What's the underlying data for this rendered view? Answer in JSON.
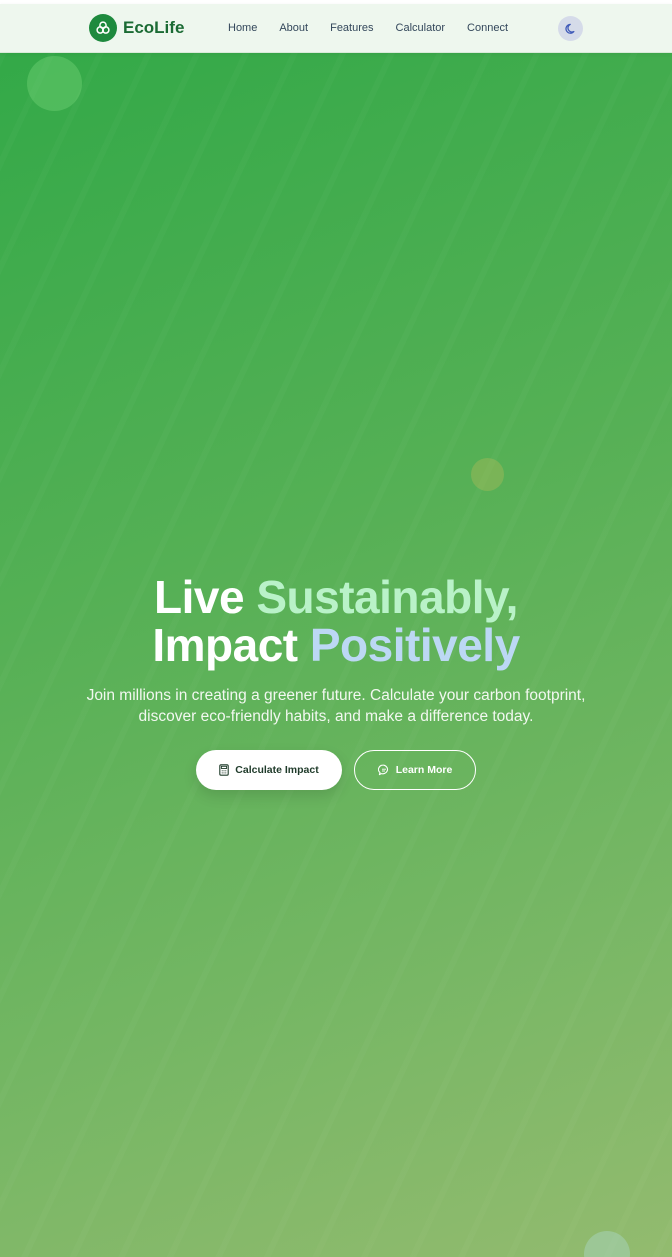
{
  "brand": {
    "name": "EcoLife",
    "logo_icon": "recycle-icon"
  },
  "nav": {
    "links": [
      {
        "label": "Home"
      },
      {
        "label": "About"
      },
      {
        "label": "Features"
      },
      {
        "label": "Calculator"
      },
      {
        "label": "Connect"
      }
    ],
    "theme_toggle_icon": "moon-icon"
  },
  "hero": {
    "title_part1": "Live",
    "title_accent1": "Sustainably,",
    "title_part2": "Impact",
    "title_accent2": "Positively",
    "subtitle": "Join millions in creating a greener future. Calculate your carbon footprint, discover eco-friendly habits, and make a difference today.",
    "primary_button": {
      "label": "Calculate Impact",
      "icon": "calculator-icon"
    },
    "secondary_button": {
      "label": "Learn More",
      "icon": "chat-icon"
    }
  },
  "colors": {
    "brand_green": "#1e8a3e",
    "hero_gradient_start": "#33a948",
    "hero_gradient_end": "#93bb6f",
    "accent_green_text": "#b9f2c8",
    "accent_blue_text": "#bcd8f4"
  }
}
